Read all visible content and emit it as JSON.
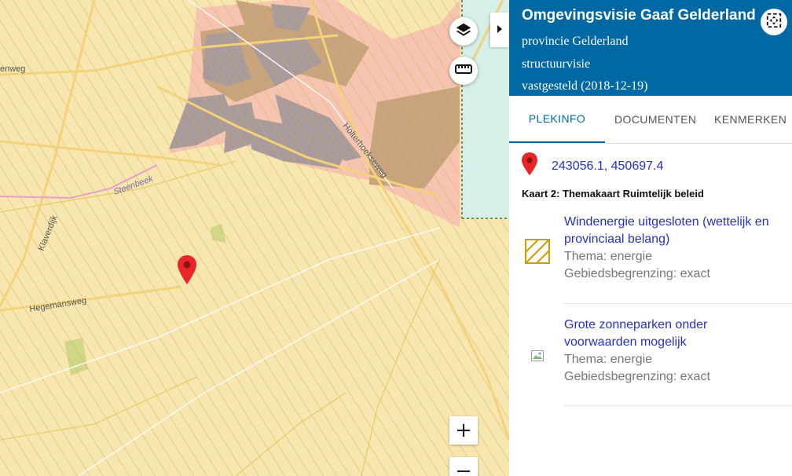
{
  "map": {
    "road_labels": {
      "enweg": "enweg",
      "klaverdijk": "Klaverdijk",
      "steenbeek": "Steenbeek",
      "hegemansweg": "Hegemansweg",
      "holterhoekseweg": "Holterhoekseweg"
    },
    "zoom_in": "+",
    "zoom_out": "−",
    "icons": {
      "layers": "layers-icon",
      "ruler": "ruler-icon",
      "marker": "map-marker-icon",
      "collapse": "caret-right-icon"
    },
    "colors": {
      "base": "#f7e6b0",
      "hatch": "#d9b24a",
      "built_area": "#a99a9c",
      "pink_area": "#f6c4b0",
      "brown_area": "#c8a47e",
      "water": "#d6efe9",
      "marker": "#e8262a"
    }
  },
  "panel": {
    "title": "Omgevingsvisie Gaaf Gelderland",
    "subtitle1": "provincie Gelderland",
    "subtitle2": "structuurvisie",
    "subtitle3": "vastgesteld (2018-12-19)",
    "tabs": [
      "PLEKINFO",
      "DOCUMENTEN",
      "KENMERKEN"
    ],
    "active_tab": "PLEKINFO",
    "coordinates": "243056.1, 450697.4",
    "kaart_title": "Kaart 2: Themakaart Ruimtelijk beleid",
    "entries": [
      {
        "name": "Windenergie uitgesloten (wettelijk en provinciaal belang)",
        "thema": "Thema: energie",
        "begrenzing": "Gebiedsbegrenzing: exact"
      },
      {
        "name": "Grote zonneparken onder voorwaarden mogelijk",
        "thema": "Thema: energie",
        "begrenzing": "Gebiedsbegrenzing: exact"
      }
    ],
    "colors": {
      "header": "#0069a3",
      "link": "#2431c8",
      "legend_hatch": "#c9a000"
    }
  }
}
